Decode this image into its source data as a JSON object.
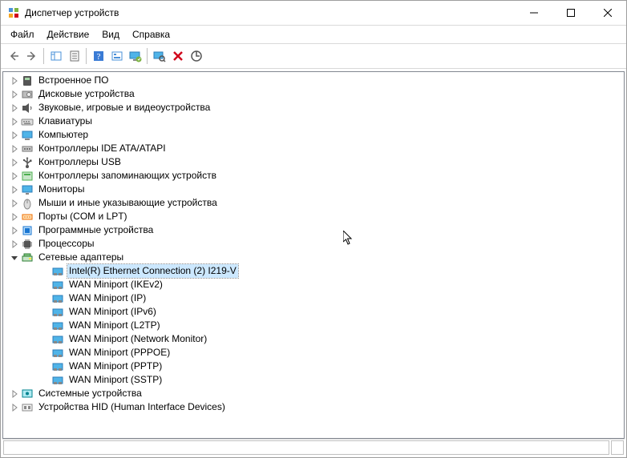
{
  "window": {
    "title": "Диспетчер устройств"
  },
  "menu": [
    "Файл",
    "Действие",
    "Вид",
    "Справка"
  ],
  "toolbar_icons": [
    "back",
    "forward",
    "|",
    "show-hide",
    "properties",
    "|",
    "help",
    "action",
    "monitor-update",
    "|",
    "scan-hardware",
    "uninstall",
    "enable-disable"
  ],
  "tree": [
    {
      "icon": "firmware",
      "label": "Встроенное ПО",
      "expanded": false,
      "children": false,
      "expander": true
    },
    {
      "icon": "disk",
      "label": "Дисковые устройства",
      "expanded": false,
      "children": false,
      "expander": true
    },
    {
      "icon": "sound",
      "label": "Звуковые, игровые и видеоустройства",
      "expanded": false,
      "children": false,
      "expander": true
    },
    {
      "icon": "keyboard",
      "label": "Клавиатуры",
      "expanded": false,
      "children": false,
      "expander": true
    },
    {
      "icon": "computer",
      "label": "Компьютер",
      "expanded": false,
      "children": false,
      "expander": true
    },
    {
      "icon": "ide",
      "label": "Контроллеры IDE ATA/ATAPI",
      "expanded": false,
      "children": false,
      "expander": true
    },
    {
      "icon": "usb",
      "label": "Контроллеры USB",
      "expanded": false,
      "children": false,
      "expander": true
    },
    {
      "icon": "storage",
      "label": "Контроллеры запоминающих устройств",
      "expanded": false,
      "children": false,
      "expander": true
    },
    {
      "icon": "monitor",
      "label": "Мониторы",
      "expanded": false,
      "children": false,
      "expander": true
    },
    {
      "icon": "mouse",
      "label": "Мыши и иные указывающие устройства",
      "expanded": false,
      "children": false,
      "expander": true
    },
    {
      "icon": "port",
      "label": "Порты (COM и LPT)",
      "expanded": false,
      "children": false,
      "expander": true
    },
    {
      "icon": "software",
      "label": "Программные устройства",
      "expanded": false,
      "children": false,
      "expander": true
    },
    {
      "icon": "cpu",
      "label": "Процессоры",
      "expanded": false,
      "children": false,
      "expander": true
    },
    {
      "icon": "network",
      "label": "Сетевые адаптеры",
      "expanded": true,
      "children": true,
      "expander": true,
      "items": [
        {
          "label": "Intel(R) Ethernet Connection (2) I219-V",
          "selected": true
        },
        {
          "label": "WAN Miniport (IKEv2)"
        },
        {
          "label": "WAN Miniport (IP)"
        },
        {
          "label": "WAN Miniport (IPv6)"
        },
        {
          "label": "WAN Miniport (L2TP)"
        },
        {
          "label": "WAN Miniport (Network Monitor)"
        },
        {
          "label": "WAN Miniport (PPPOE)"
        },
        {
          "label": "WAN Miniport (PPTP)"
        },
        {
          "label": "WAN Miniport (SSTP)"
        }
      ]
    },
    {
      "icon": "system",
      "label": "Системные устройства",
      "expanded": false,
      "children": false,
      "expander": true
    },
    {
      "icon": "hid",
      "label": "Устройства HID (Human Interface Devices)",
      "expanded": false,
      "children": false,
      "expander": true
    }
  ]
}
